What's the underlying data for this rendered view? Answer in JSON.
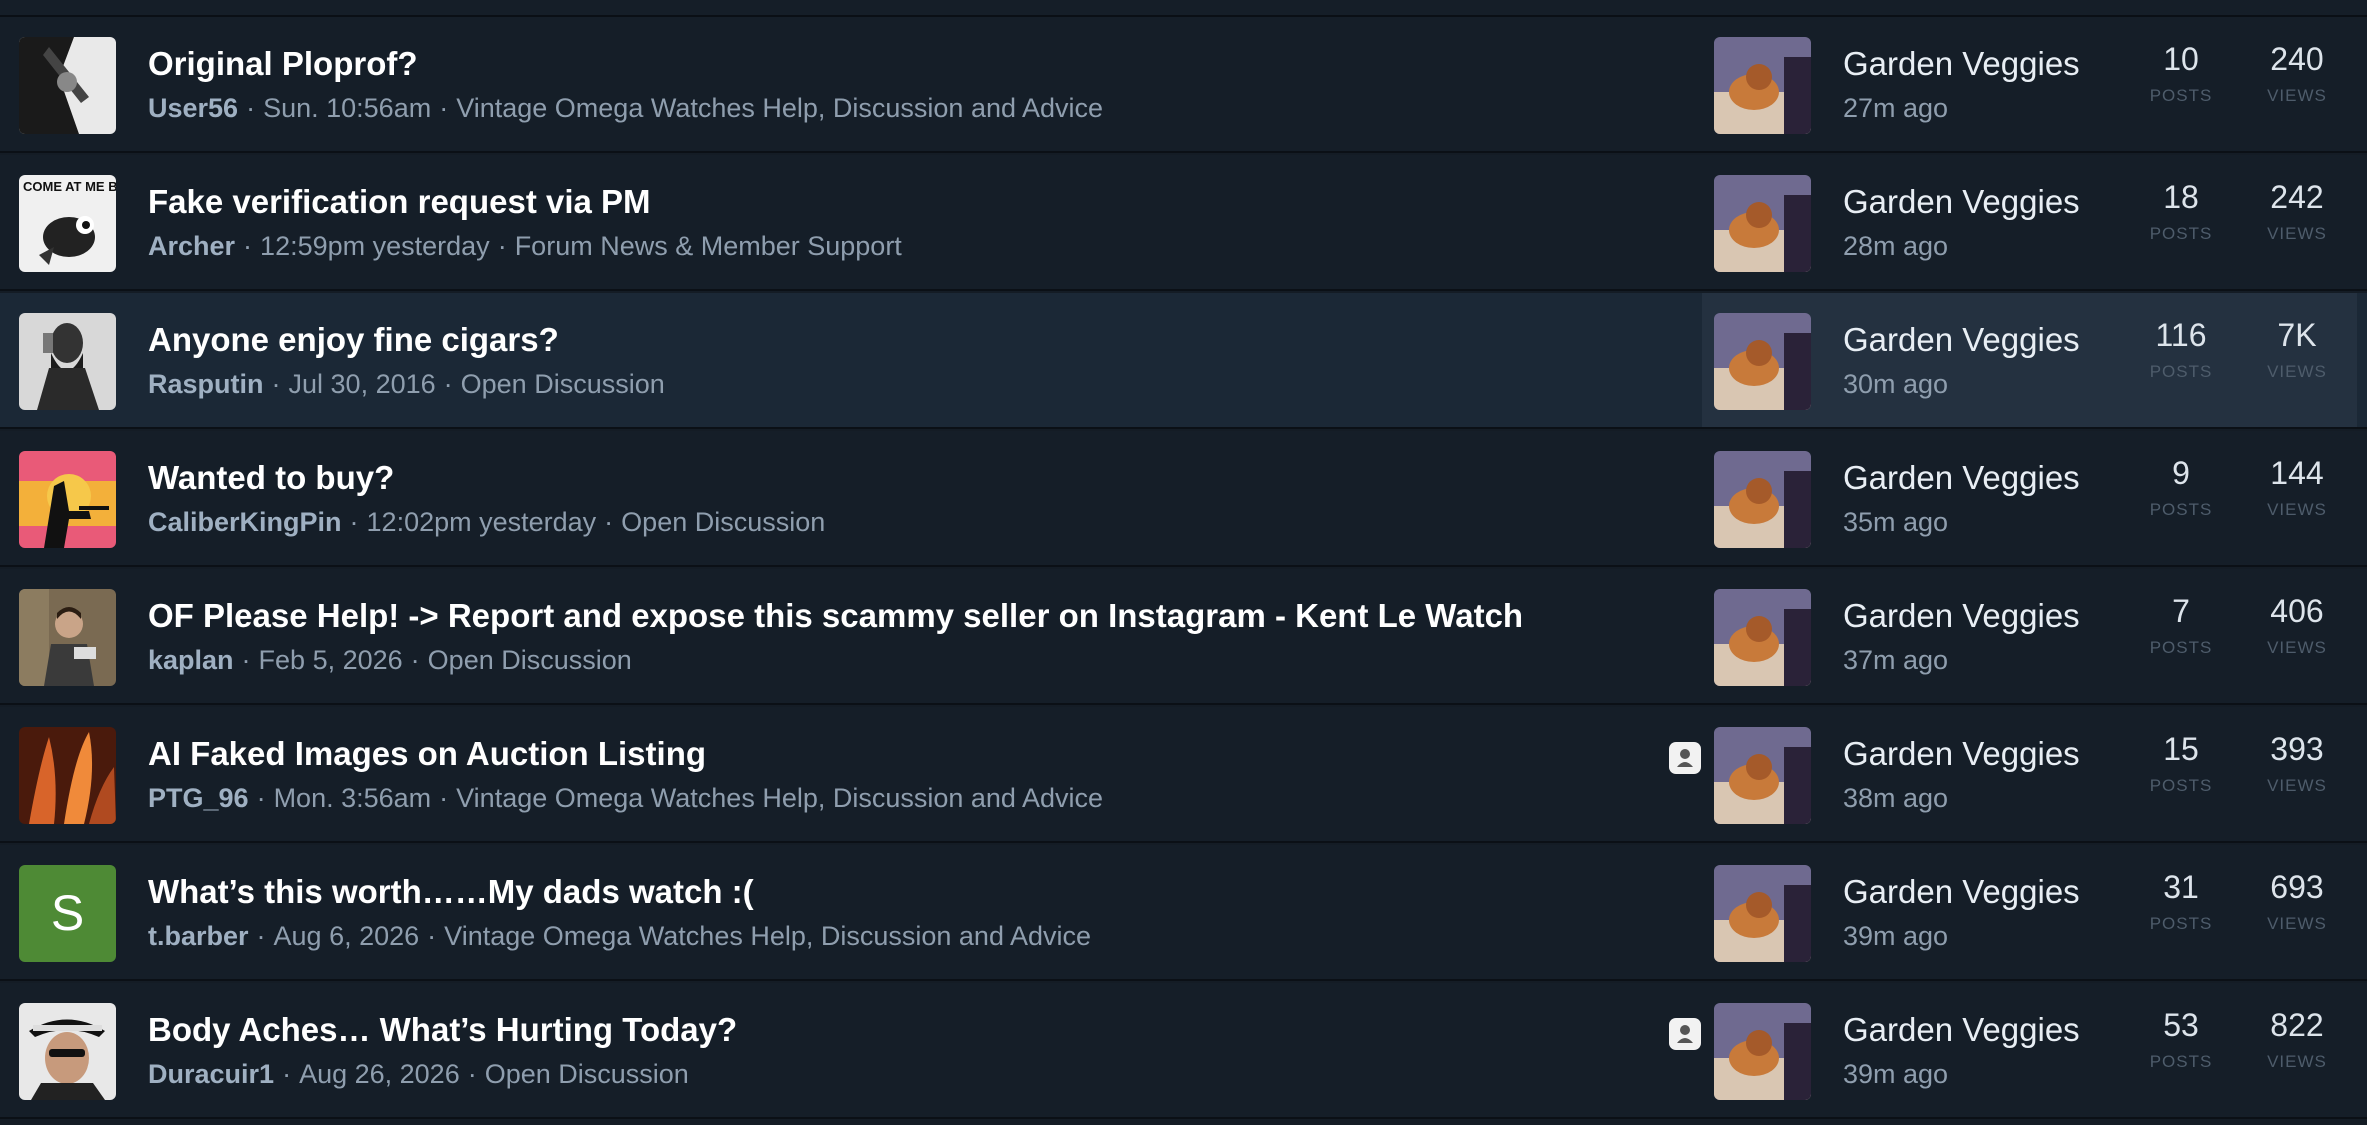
{
  "stat_labels": {
    "posts": "POSTS",
    "views": "VIEWS"
  },
  "separator": "·",
  "topics": [
    {
      "title": "Original Ploprof?",
      "author": "User56",
      "date": "Sun. 10:56am",
      "category": "Vintage Omega Watches Help, Discussion and Advice",
      "last_user": "Garden Veggies",
      "last_time": "27m ago",
      "posts": "10",
      "views": "240"
    },
    {
      "title": "Fake verification request via PM",
      "author": "Archer",
      "date": "12:59pm yesterday",
      "category": "Forum News & Member Support",
      "last_user": "Garden Veggies",
      "last_time": "28m ago",
      "posts": "18",
      "views": "242",
      "avatar_text": "COME AT ME BRO!"
    },
    {
      "title": "Anyone enjoy fine cigars?",
      "author": "Rasputin",
      "date": "Jul 30, 2016",
      "category": "Open Discussion",
      "last_user": "Garden Veggies",
      "last_time": "30m ago",
      "posts": "116",
      "views": "7K"
    },
    {
      "title": "Wanted to buy?",
      "author": "CaliberKingPin",
      "date": "12:02pm yesterday",
      "category": "Open Discussion",
      "last_user": "Garden Veggies",
      "last_time": "35m ago",
      "posts": "9",
      "views": "144"
    },
    {
      "title": "OF Please Help! -> Report and expose this scammy seller on Instagram - Kent Le Watch",
      "author": "kaplan",
      "date": "Feb 5, 2026",
      "category": "Open Discussion",
      "last_user": "Garden Veggies",
      "last_time": "37m ago",
      "posts": "7",
      "views": "406"
    },
    {
      "title": "AI Faked Images on Auction Listing",
      "author": "PTG_96",
      "date": "Mon. 3:56am",
      "category": "Vintage Omega Watches Help, Discussion and Advice",
      "last_user": "Garden Veggies",
      "last_time": "38m ago",
      "posts": "15",
      "views": "393",
      "badge_icon": "moderator-badge-icon"
    },
    {
      "title": "What’s this worth……My dads watch :(",
      "author": "t.barber",
      "date": "Aug 6, 2026",
      "category": "Vintage Omega Watches Help, Discussion and Advice",
      "last_user": "Garden Veggies",
      "last_time": "39m ago",
      "posts": "31",
      "views": "693",
      "avatar_letter": "S"
    },
    {
      "title": "Body Aches… What’s Hurting Today?",
      "author": "Duracuir1",
      "date": "Aug 26, 2026",
      "category": "Open Discussion",
      "last_user": "Garden Veggies",
      "last_time": "39m ago",
      "posts": "53",
      "views": "822",
      "badge_icon": "moderator-badge-icon"
    }
  ],
  "colors": {
    "background": "#141c25",
    "row_hover": "#1b2836",
    "title": "#ffffff",
    "meta": "#8f9eae",
    "letter_avatar": "#4e8a35"
  }
}
